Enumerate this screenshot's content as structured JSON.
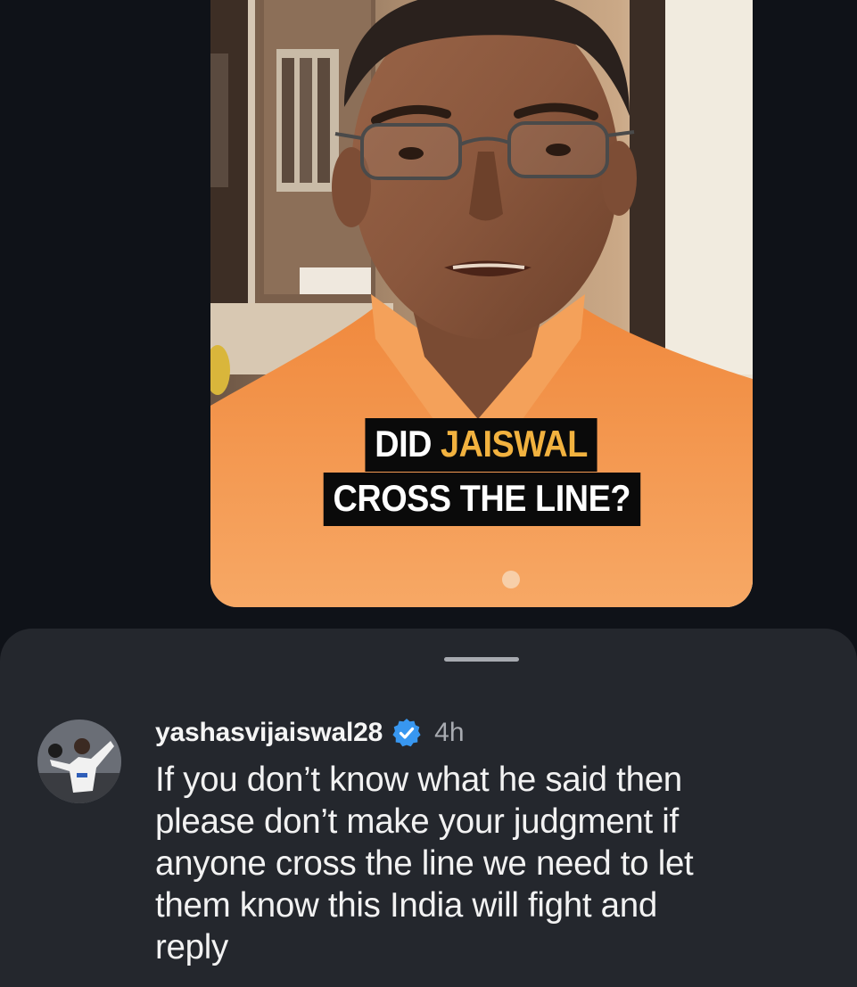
{
  "video": {
    "caption_line1_prefix": "DID ",
    "caption_line1_accent": "JAISWAL",
    "caption_line2": "CROSS THE LINE?",
    "accent_color": "#f2b23f",
    "shirt_color": "#f39a52"
  },
  "comments_sheet": {
    "comment": {
      "username": "yashasvijaiswal28",
      "verified": true,
      "verified_icon": "verified-badge-icon",
      "timestamp": "4h",
      "text": "If you don’t know what he said then\nplease don’t make your judgment if\nanyone cross the line we need to let\nthem know this India will fight and\nreply"
    }
  }
}
